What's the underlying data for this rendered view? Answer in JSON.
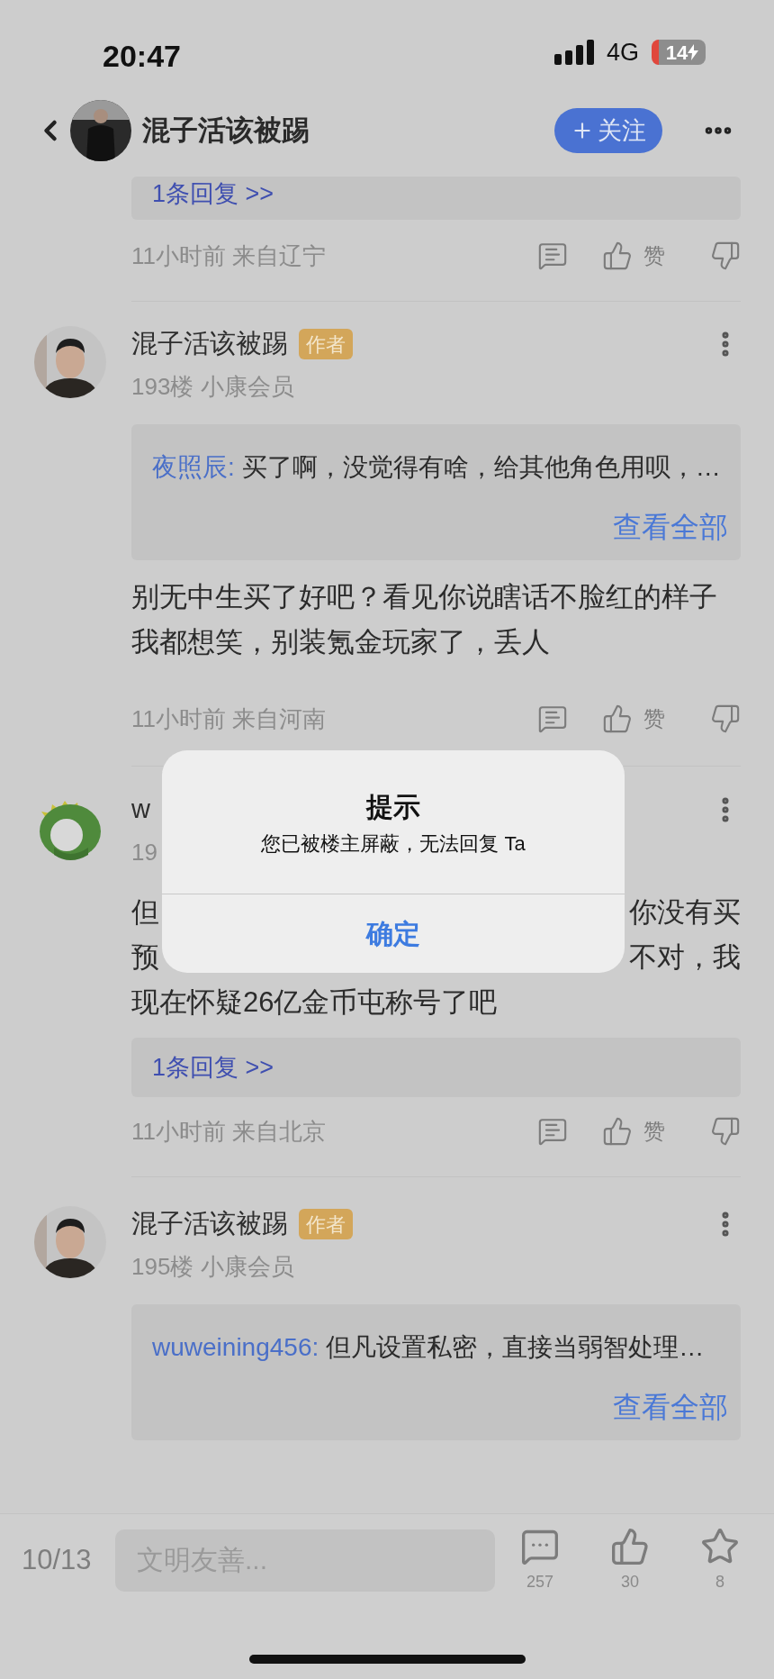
{
  "status_bar": {
    "time": "20:47",
    "network": "4G",
    "battery": "14",
    "charging": true
  },
  "header": {
    "title": "混子活该被踢",
    "follow": "关注"
  },
  "posts": [
    {
      "replies": "1条回复 >>",
      "meta": "11小时前 来自辽宁",
      "like": "赞"
    },
    {
      "kind": "person",
      "author": "混子活该被踢",
      "badge": "作者",
      "floor": "193楼 小康会员",
      "quote": {
        "user": "夜照辰:",
        "text": "买了啊，没觉得有啥，给其他角色用呗，…",
        "more": "查看全部"
      },
      "body": "别无中生买了好吧？看见你说瞎话不脸红的样子我都想笑，别装氪金玩家了，丢人",
      "meta": "11小时前 来自河南",
      "like": "赞"
    },
    {
      "kind": "dino",
      "author": "w",
      "floor": "19",
      "body_lines": [
        {
          "left": "但",
          "right": "你没有买"
        },
        {
          "left": "预",
          "right": "不对，我"
        },
        {
          "left": "现在怀疑26亿金币屯称号了吧"
        }
      ],
      "replies": "1条回复 >>",
      "meta": "11小时前 来自北京",
      "like": "赞"
    },
    {
      "kind": "person",
      "author": "混子活该被踢",
      "badge": "作者",
      "floor": "195楼 小康会员",
      "quote": {
        "user": "wuweining456:",
        "text": "但凡设置私密，直接当弱智处理…",
        "more": "查看全部"
      }
    }
  ],
  "bottom_bar": {
    "page": "10/13",
    "placeholder": "文明友善...",
    "actions": [
      {
        "kind": "comment",
        "count": "257"
      },
      {
        "kind": "like",
        "count": "30"
      },
      {
        "kind": "favorite",
        "count": "8"
      }
    ]
  },
  "dialog": {
    "title": "提示",
    "message": "您已被楼主屏蔽，无法回复 Ta",
    "button": "确定"
  }
}
